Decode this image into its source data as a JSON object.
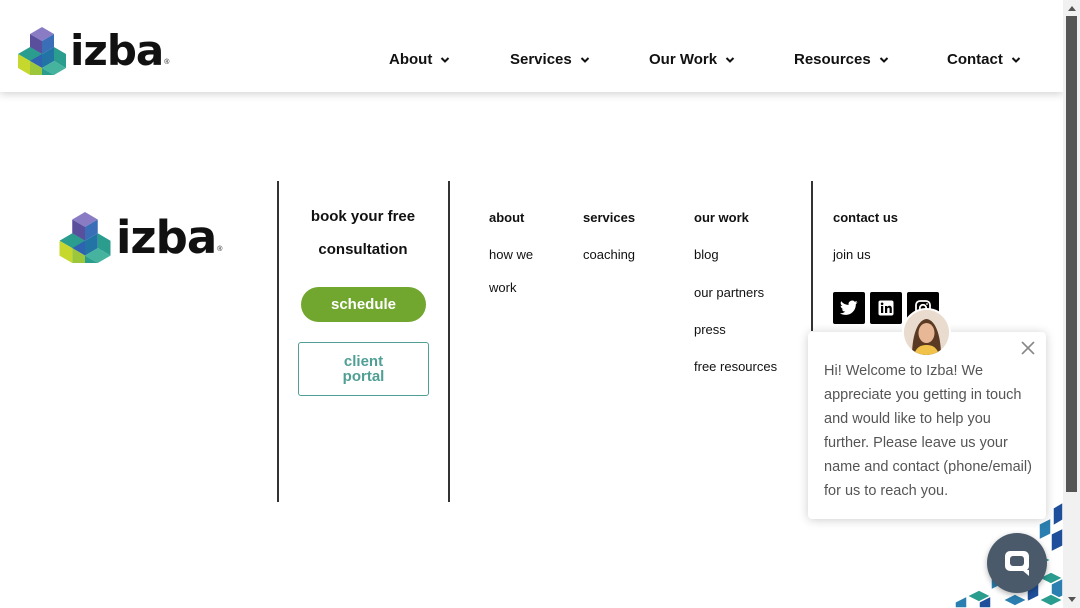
{
  "header": {
    "logo_text": "izba",
    "logo_reg": "®",
    "nav": [
      {
        "label": "About"
      },
      {
        "label": "Services"
      },
      {
        "label": "Our Work"
      },
      {
        "label": "Resources"
      },
      {
        "label": "Contact"
      }
    ]
  },
  "footer": {
    "logo_text": "izba",
    "logo_reg": "®",
    "cta": {
      "title_line1": "book your free",
      "title_line2": "consultation",
      "schedule_label": "schedule",
      "portal_line1": "client",
      "portal_line2": "portal"
    },
    "columns": {
      "about": {
        "heading": "about",
        "links": [
          "how we",
          "work"
        ]
      },
      "services": {
        "heading": "services",
        "links": [
          "coaching"
        ]
      },
      "our_work": {
        "heading": "our work",
        "links": [
          "blog",
          "our partners",
          "press",
          "free resources"
        ]
      },
      "contact": {
        "heading": "contact us",
        "links": [
          "join us"
        ]
      }
    },
    "social": [
      "twitter-icon",
      "linkedin-icon",
      "instagram-icon"
    ]
  },
  "chat": {
    "message": "Hi! Welcome to Izba! We appreciate you getting in touch and would like to help you further. Please leave us your name and contact (phone/email) for us to reach you."
  },
  "colors": {
    "accent_green": "#72a72f",
    "teal": "#4f9f95",
    "chat_bubble": "#4a5a6a",
    "cube_purple": "#6b5ea8",
    "cube_blue": "#2c5fa8",
    "cube_teal": "#2a9d8f",
    "cube_lime": "#c6d82e"
  }
}
